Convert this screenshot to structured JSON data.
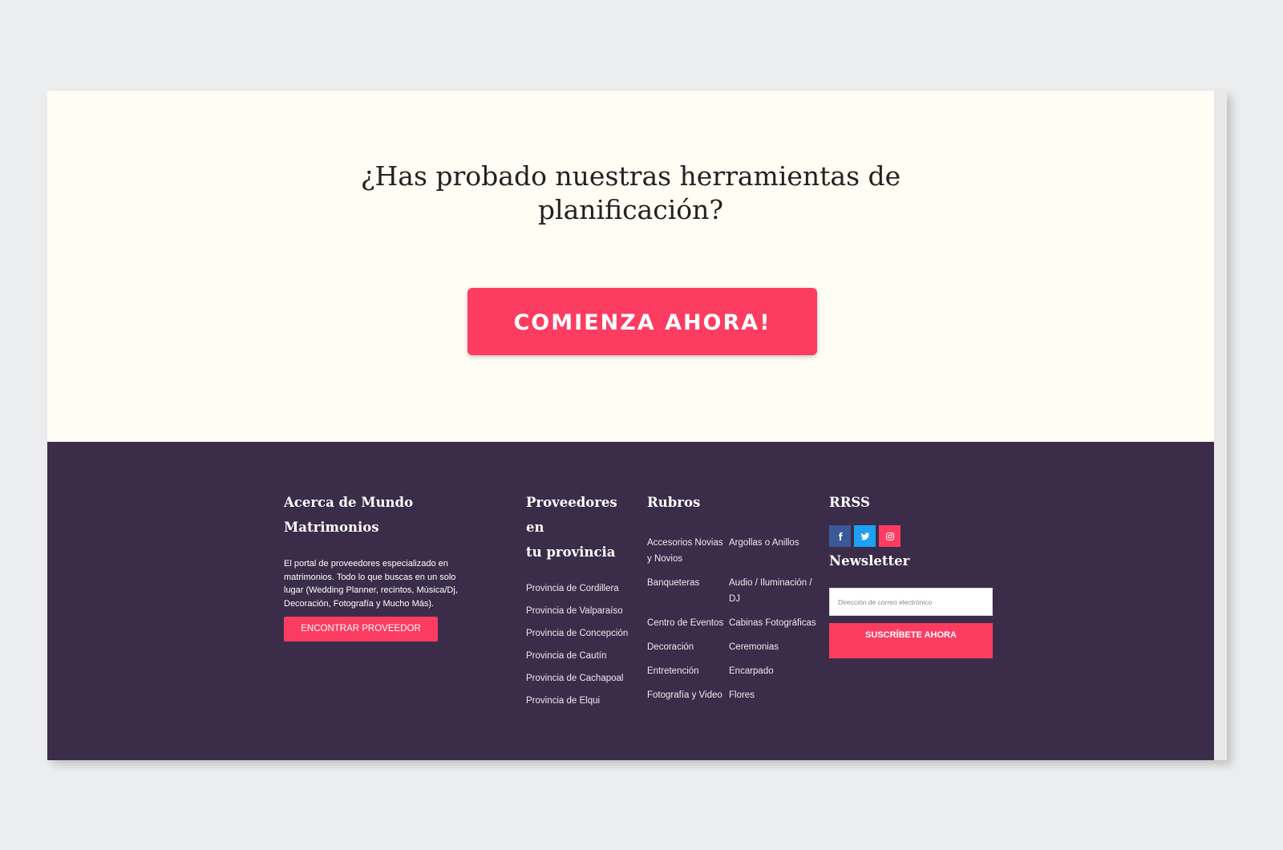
{
  "hero": {
    "title_line1": "¿Has probado nuestras herramientas de",
    "title_line2": "planificación?",
    "cta_label": "COMIENZA AHORA!"
  },
  "footer": {
    "about": {
      "title_line1": "Acerca de Mundo",
      "title_line2": "Matrimonios",
      "text": "El portal de proveedores especializado en matrimonios. Todo  lo que buscas en un solo lugar (Wedding Planner, recintos, Música/Dj, Decoración, Fotografía y Mucho Más).",
      "button_label": "ENCONTRAR PROVEEDOR"
    },
    "provinces": {
      "title_line1": "Proveedores en",
      "title_line2": "tu provincia",
      "items": [
        "Provincia de Cordillera",
        "Provincia de Valparaíso",
        "Provincia de Concepción",
        "Provincia de Cautín",
        "Provincia de Cachapoal",
        "Provincia de Elqui"
      ]
    },
    "rubros": {
      "title": "Rubros",
      "left": [
        "Accesorios Novias y Novios",
        "Banqueteras",
        "Centro de Eventos",
        "Decoración",
        "Entretención",
        "Fotografía y Video"
      ],
      "right": [
        "Argollas o Anillos",
        "Audio / Iluminación / DJ",
        "Cabinas Fotográficas",
        "Ceremonias",
        "Encarpado",
        "Flores"
      ]
    },
    "rrss": {
      "title": "RRSS",
      "icons": [
        "facebook-icon",
        "twitter-icon",
        "instagram-icon"
      ]
    },
    "newsletter": {
      "title": "Newsletter",
      "email_placeholder": "Dirección de correo electrónico",
      "email_value": "",
      "subscribe_label": "SUSCRÍBETE AHORA"
    }
  },
  "colors": {
    "accent": "#fd3c61",
    "footer_bg": "#3b2d49",
    "hero_bg": "#fffdf4",
    "page_bg": "#ecedee"
  }
}
